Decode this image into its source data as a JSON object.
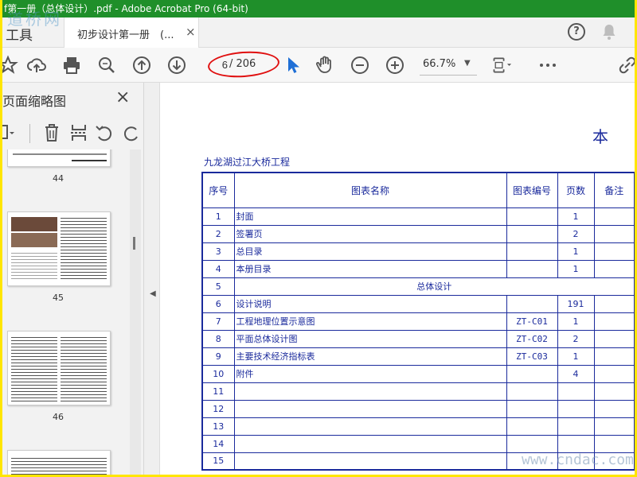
{
  "window": {
    "title": "f第一册（总体设计）.pdf - Adobe Acrobat Pro (64-bit)",
    "watermark_top": "道桥网"
  },
  "tabs": {
    "tools_label": "工具",
    "document_tab_label": "初步设计第一册　(...",
    "document_tab_close": "×"
  },
  "toolbar": {
    "page_current": "6",
    "page_total": "/ 206",
    "zoom": "66.7%",
    "icons": [
      "star-icon",
      "cloud-upload-icon",
      "print-icon",
      "zoom-search-icon",
      "page-up-icon",
      "page-down-icon",
      "select-cursor-icon",
      "hand-icon",
      "zoom-out-icon",
      "zoom-in-icon",
      "fit-page-icon",
      "more-icon",
      "link-icon"
    ],
    "highlight_color": "#e01010"
  },
  "sidebar": {
    "title": "页面缩略图",
    "close": "×",
    "thumbnails": [
      {
        "label": "44"
      },
      {
        "label": "45"
      },
      {
        "label": "46"
      }
    ]
  },
  "document": {
    "heading": "本　册",
    "project_name": "九龙湖过江大桥工程",
    "columns": [
      "序号",
      "图表名称",
      "图表编号",
      "页数",
      "备注"
    ],
    "rows": [
      {
        "no": "1",
        "name": "封面",
        "code": "",
        "pages": "1",
        "note": ""
      },
      {
        "no": "2",
        "name": "签署页",
        "code": "",
        "pages": "2",
        "note": ""
      },
      {
        "no": "3",
        "name": "总目录",
        "code": "",
        "pages": "1",
        "note": ""
      },
      {
        "no": "4",
        "name": "本册目录",
        "code": "",
        "pages": "1",
        "note": ""
      },
      {
        "no": "5",
        "section": "总体设计"
      },
      {
        "no": "6",
        "name": "设计说明",
        "code": "",
        "pages": "191",
        "note": ""
      },
      {
        "no": "7",
        "name": "工程地理位置示意图",
        "code": "ZT-C01",
        "pages": "1",
        "note": ""
      },
      {
        "no": "8",
        "name": "平面总体设计图",
        "code": "ZT-C02",
        "pages": "2",
        "note": ""
      },
      {
        "no": "9",
        "name": "主要技术经济指标表",
        "code": "ZT-C03",
        "pages": "1",
        "note": ""
      },
      {
        "no": "10",
        "name": "附件",
        "code": "",
        "pages": "4",
        "note": ""
      },
      {
        "no": "11",
        "name": "",
        "code": "",
        "pages": "",
        "note": ""
      },
      {
        "no": "12",
        "name": "",
        "code": "",
        "pages": "",
        "note": ""
      },
      {
        "no": "13",
        "name": "",
        "code": "",
        "pages": "",
        "note": ""
      },
      {
        "no": "14",
        "name": "",
        "code": "",
        "pages": "",
        "note": ""
      },
      {
        "no": "15",
        "name": "",
        "code": "",
        "pages": "",
        "note": ""
      }
    ],
    "text_color": "#1a2a9c"
  },
  "watermark_bottom": "www.cndac.com"
}
